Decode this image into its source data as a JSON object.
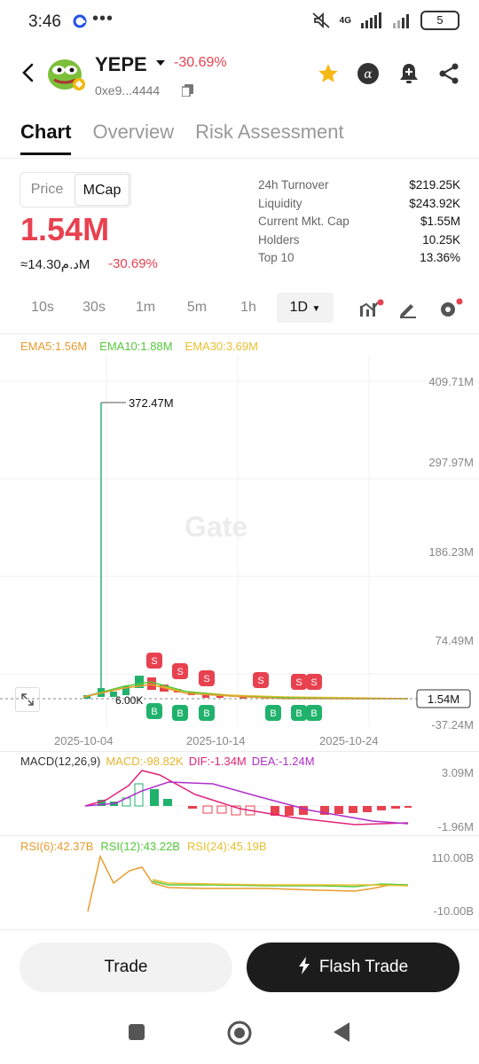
{
  "status_bar": {
    "time": "3:46",
    "dots": "•••",
    "network": "4G",
    "battery": "5"
  },
  "header": {
    "token_name": "YEPE",
    "change": "-30.69%",
    "address": "0xe9...4444"
  },
  "tabs": [
    "Chart",
    "Overview",
    "Risk Assessment"
  ],
  "toggle": {
    "price": "Price",
    "mcap": "MCap"
  },
  "price": {
    "main": "1.54M",
    "local": "≈14.30د.مM",
    "change": "-30.69%"
  },
  "stats": [
    {
      "label": "24h Turnover",
      "value": "$219.25K"
    },
    {
      "label": "Liquidity",
      "value": "$243.92K"
    },
    {
      "label": "Current Mkt. Cap",
      "value": "$1.55M"
    },
    {
      "label": "Holders",
      "value": "10.25K"
    },
    {
      "label": "Top 10",
      "value": "13.36%"
    }
  ],
  "timeframes": [
    "10s",
    "30s",
    "1m",
    "5m",
    "1h",
    "1D"
  ],
  "ema": {
    "ema5": "EMA5:1.56M",
    "ema10": "EMA10:1.88M",
    "ema30": "EMA30:3.69M"
  },
  "chart": {
    "y_ticks": [
      "409.71M",
      "297.97M",
      "186.23M",
      "74.49M",
      "-37.24M"
    ],
    "x_ticks": [
      "2025-10-04",
      "2025-10-14",
      "2025-10-24"
    ],
    "high_label": "372.47M",
    "low_label": "6.00K",
    "current_label": "1.54M",
    "watermark": "Gate",
    "sell_marker": "S",
    "buy_marker": "B"
  },
  "macd": {
    "title": "MACD(12,26,9)",
    "macd": "MACD:-98.82K",
    "dif": "DIF:-1.34M",
    "dea": "DEA:-1.24M",
    "y_ticks": [
      "3.09M",
      "-1.96M"
    ]
  },
  "rsi": {
    "r6": "RSI(6):42.37B",
    "r12": "RSI(12):43.22B",
    "r24": "RSI(24):45.19B",
    "y_ticks": [
      "110.00B",
      "-10.00B"
    ]
  },
  "buttons": {
    "trade": "Trade",
    "flash": "Flash Trade"
  },
  "colors": {
    "red": "#e8414f",
    "green": "#20b26c",
    "ema5": "#e89c2f",
    "ema10": "#55c93a",
    "ema30": "#e8c02f",
    "dif": "#e0247a",
    "dea": "#b02fc9"
  }
}
